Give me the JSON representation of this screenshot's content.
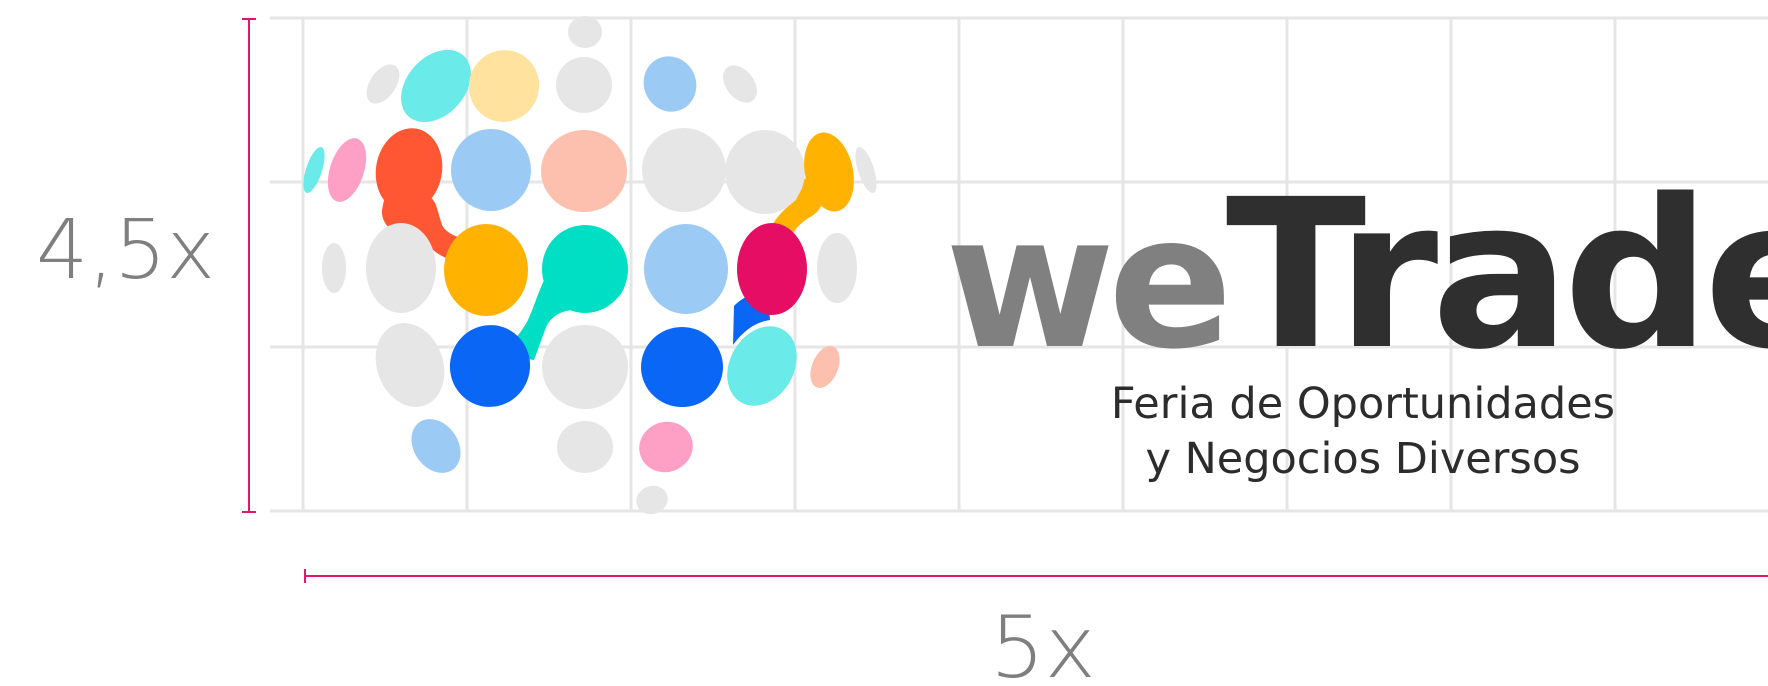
{
  "measurements": {
    "height_ratio": "4,5x",
    "width_ratio": "5x"
  },
  "brand": {
    "word_light": "we",
    "word_dark": "Trade",
    "tagline_line1": "Feria de Oportunidades",
    "tagline_line2": "y Negocios Diversos"
  },
  "colors": {
    "measure_line": "#e2166b",
    "grid_line": "#e6e6e6",
    "label_gray": "#7f7f7f",
    "word_light_gray": "#808080",
    "word_dark": "#2f2f2f",
    "dot_gray": "#e6e6e6",
    "cyan": "#6aeae8",
    "yellow_light": "#fee29e",
    "blue_light": "#9bcaf4",
    "pink": "#fe9fc5",
    "red_orange": "#ff5733",
    "peach": "#fdbfae",
    "amber": "#ffb300",
    "teal": "#00dfc3",
    "magenta": "#e60e64",
    "blue": "#0a66f5"
  }
}
